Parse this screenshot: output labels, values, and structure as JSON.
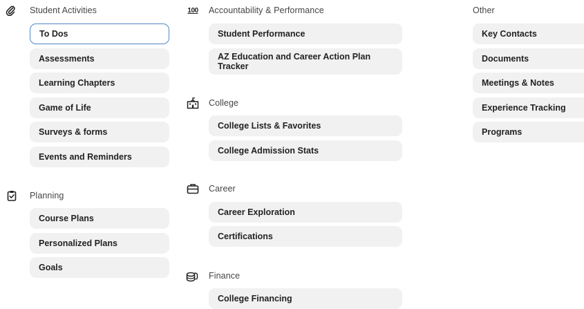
{
  "student_activities": {
    "title": "Student Activities",
    "icon": "paperclip-icon",
    "items": [
      "To Dos",
      "Assessments",
      "Learning Chapters",
      "Game of Life",
      "Surveys & forms",
      "Events and Reminders"
    ],
    "selected": "To Dos"
  },
  "planning": {
    "title": "Planning",
    "icon": "clipboard-check-icon",
    "items": [
      "Course Plans",
      "Personalized Plans",
      "Goals"
    ]
  },
  "accountability": {
    "title": "Accountability & Performance",
    "icon": "hundred-points-icon",
    "icon_text": "100",
    "items": [
      "Student Performance",
      "AZ Education and Career Action Plan Tracker"
    ]
  },
  "college": {
    "title": "College",
    "icon": "school-building-icon",
    "items": [
      "College Lists & Favorites",
      "College Admission Stats"
    ]
  },
  "career": {
    "title": "Career",
    "icon": "briefcase-icon",
    "items": [
      "Career Exploration",
      "Certifications"
    ]
  },
  "finance": {
    "title": "Finance",
    "icon": "coins-icon",
    "items": [
      "College Financing"
    ]
  },
  "other": {
    "title": "Other",
    "items": [
      "Key Contacts",
      "Documents",
      "Meetings & Notes",
      "Experience Tracking",
      "Programs"
    ]
  },
  "colors": {
    "item_bg": "#f1f1f2",
    "selected_border": "#4f86c6"
  }
}
